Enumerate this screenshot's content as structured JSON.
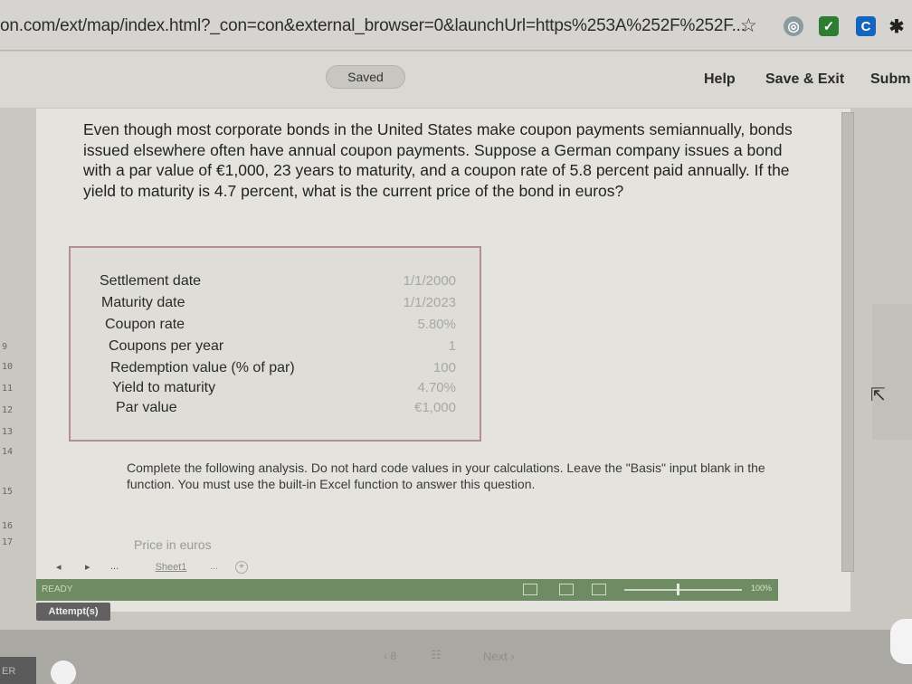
{
  "browser": {
    "url": "on.com/ext/map/index.html?_con=con&external_browser=0&launchUrl=https%253A%252F%252F..."
  },
  "header": {
    "saved_label": "Saved",
    "help_label": "Help",
    "save_exit_label": "Save & Exit",
    "submit_label": "Subm"
  },
  "question": {
    "text": "Even though most corporate bonds in the United States make coupon payments semiannually, bonds issued elsewhere often have annual coupon payments. Suppose a German company issues a bond with a par value of €1,000, 23 years to maturity, and a coupon rate of 5.8 percent paid annually. If the yield to maturity is 4.7 percent, what is the current price of the bond in euros?"
  },
  "inputs": [
    {
      "label": "Settlement date",
      "value": "1/1/2000"
    },
    {
      "label": "Maturity date",
      "value": "1/1/2023"
    },
    {
      "label": "Coupon rate",
      "value": "5.80%"
    },
    {
      "label": "Coupons per year",
      "value": "1"
    },
    {
      "label": "Redemption value (% of par)",
      "value": "100"
    },
    {
      "label": "Yield to maturity",
      "value": "4.70%"
    },
    {
      "label": "Par value",
      "value": "€1,000"
    }
  ],
  "row_numbers": [
    "9",
    "10",
    "11",
    "12",
    "13",
    "14",
    "15",
    "16",
    "17"
  ],
  "instructions": "Complete the following analysis. Do not hard code values in your calculations. Leave the \"Basis\" input blank in the function. You must use the built-in Excel function to answer this question.",
  "price_label": "Price in euros",
  "sheet": {
    "tab_label": "Sheet1",
    "more_label": "...",
    "add_label": "+",
    "prev_label": "◂",
    "next_label": "▸",
    "ellipsis_label": "..."
  },
  "status": {
    "ready_label": "READY",
    "zoom_label": "100%"
  },
  "attempts_label": "Attempt(s)",
  "footer": {
    "page_nav": "‹ 8 ",
    "next_label": "Next ›",
    "corner_label": "ER"
  }
}
